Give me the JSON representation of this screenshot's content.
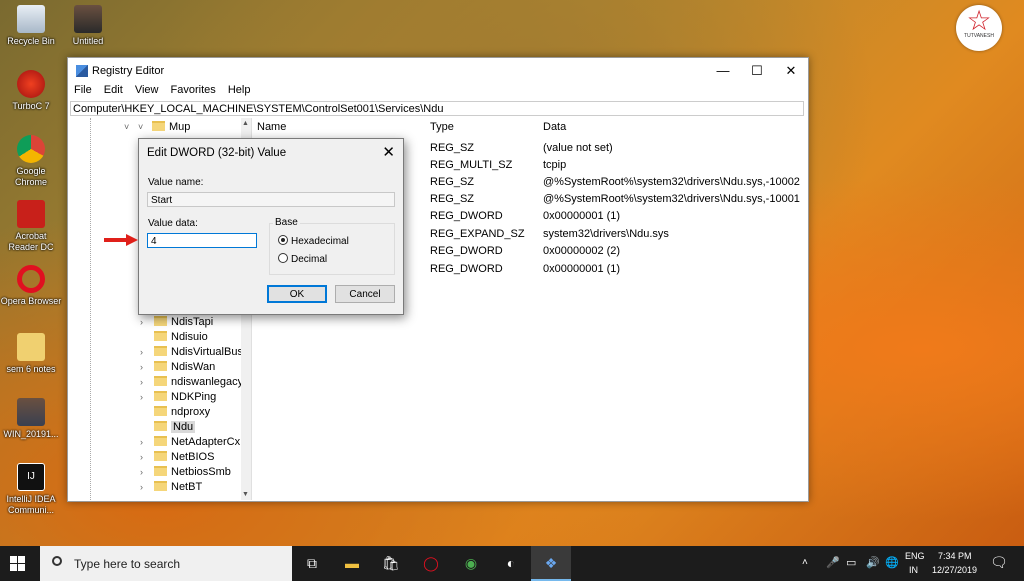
{
  "desktop": {
    "icons": [
      {
        "label": "Recycle Bin"
      },
      {
        "label": "Untitled"
      },
      {
        "label": "TurboC 7"
      },
      {
        "label": "Google Chrome"
      },
      {
        "label": "Acrobat Reader DC"
      },
      {
        "label": "Opera Browser"
      },
      {
        "label": "sem 6 notes"
      },
      {
        "label": "WIN_20191..."
      },
      {
        "label": "IntelliJ IDEA Communi..."
      }
    ],
    "logo_text": "TUTVANESH"
  },
  "regedit": {
    "title": "Registry Editor",
    "menu": [
      "File",
      "Edit",
      "View",
      "Favorites",
      "Help"
    ],
    "address": "Computer\\HKEY_LOCAL_MACHINE\\SYSTEM\\ControlSet001\\Services\\Ndu",
    "tree": [
      {
        "label": "Mup",
        "chev": "˅",
        "selected": false
      },
      {
        "label": "NdisTapi",
        "chev": "›"
      },
      {
        "label": "Ndisuio",
        "chev": ""
      },
      {
        "label": "NdisVirtualBus",
        "chev": "›"
      },
      {
        "label": "NdisWan",
        "chev": "›"
      },
      {
        "label": "ndiswanlegacy",
        "chev": "›"
      },
      {
        "label": "NDKPing",
        "chev": "›"
      },
      {
        "label": "ndproxy",
        "chev": ""
      },
      {
        "label": "Ndu",
        "chev": "",
        "selected": true
      },
      {
        "label": "NetAdapterCx",
        "chev": "›"
      },
      {
        "label": "NetBIOS",
        "chev": "›"
      },
      {
        "label": "NetbiosSmb",
        "chev": "›"
      },
      {
        "label": "NetBT",
        "chev": "›"
      }
    ],
    "columns": {
      "name": "Name",
      "type": "Type",
      "data": "Data"
    },
    "values": [
      {
        "type": "REG_SZ",
        "data": "(value not set)"
      },
      {
        "type": "REG_MULTI_SZ",
        "data": "tcpip"
      },
      {
        "type": "REG_SZ",
        "data": "@%SystemRoot%\\system32\\drivers\\Ndu.sys,-10002"
      },
      {
        "type": "REG_SZ",
        "data": "@%SystemRoot%\\system32\\drivers\\Ndu.sys,-10001"
      },
      {
        "type": "REG_DWORD",
        "data": "0x00000001 (1)"
      },
      {
        "type": "REG_EXPAND_SZ",
        "data": "system32\\drivers\\Ndu.sys"
      },
      {
        "type": "REG_DWORD",
        "data": "0x00000002 (2)"
      },
      {
        "type": "REG_DWORD",
        "data": "0x00000001 (1)"
      }
    ]
  },
  "dialog": {
    "title": "Edit DWORD (32-bit) Value",
    "value_name_label": "Value name:",
    "value_name": "Start",
    "value_data_label": "Value data:",
    "value_data": "4",
    "base_label": "Base",
    "hex_label": "Hexadecimal",
    "dec_label": "Decimal",
    "ok": "OK",
    "cancel": "Cancel"
  },
  "taskbar": {
    "search_placeholder": "Type here to search",
    "lang_top": "ENG",
    "lang_bottom": "IN",
    "time": "7:34 PM",
    "date": "12/27/2019"
  }
}
